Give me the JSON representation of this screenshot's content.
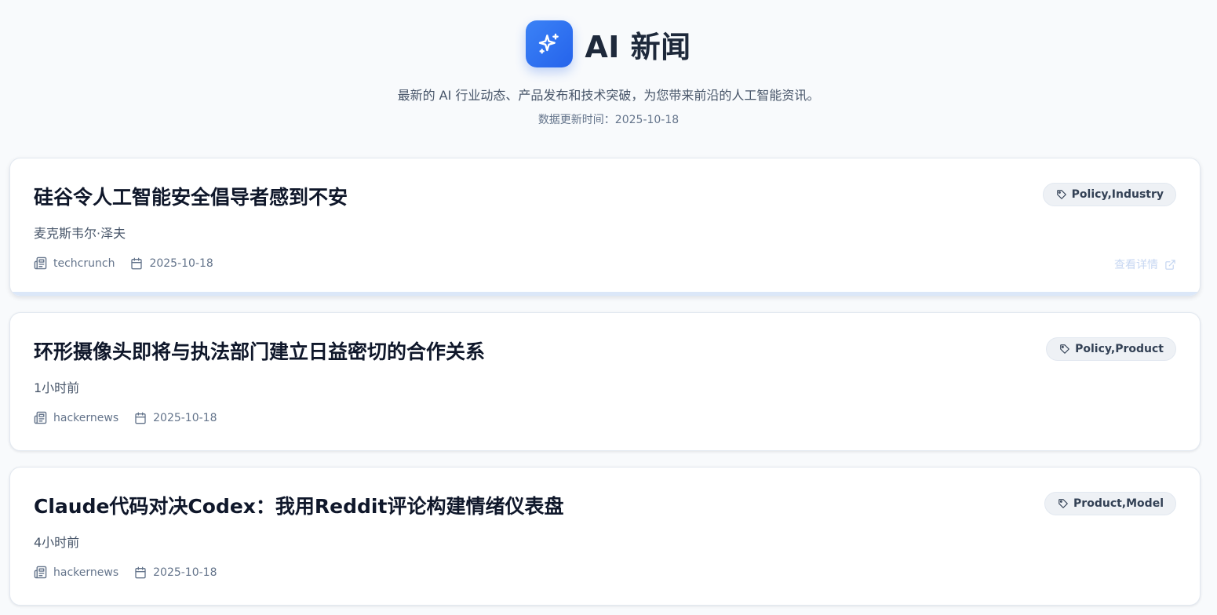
{
  "header": {
    "title": "AI 新闻",
    "subtitle": "最新的 AI 行业动态、产品发布和技术突破，为您带来前沿的人工智能资讯。",
    "updated": "数据更新时间：2025-10-18"
  },
  "articles": [
    {
      "title": "硅谷令人工智能安全倡导者感到不安",
      "summary": "麦克斯韦尔·泽夫",
      "source": "techcrunch",
      "date": "2025-10-18",
      "tag": "Policy,Industry",
      "detail_label": "查看详情"
    },
    {
      "title": "环形摄像头即将与执法部门建立日益密切的合作关系",
      "summary": "1小时前",
      "source": "hackernews",
      "date": "2025-10-18",
      "tag": "Policy,Product"
    },
    {
      "title": "Claude代码对决Codex：我用Reddit评论构建情绪仪表盘",
      "summary": "4小时前",
      "source": "hackernews",
      "date": "2025-10-18",
      "tag": "Product,Model"
    }
  ],
  "colors": {
    "accent": "#2563eb",
    "background": "#f8fafc",
    "tag_bg": "#eef1f5"
  }
}
